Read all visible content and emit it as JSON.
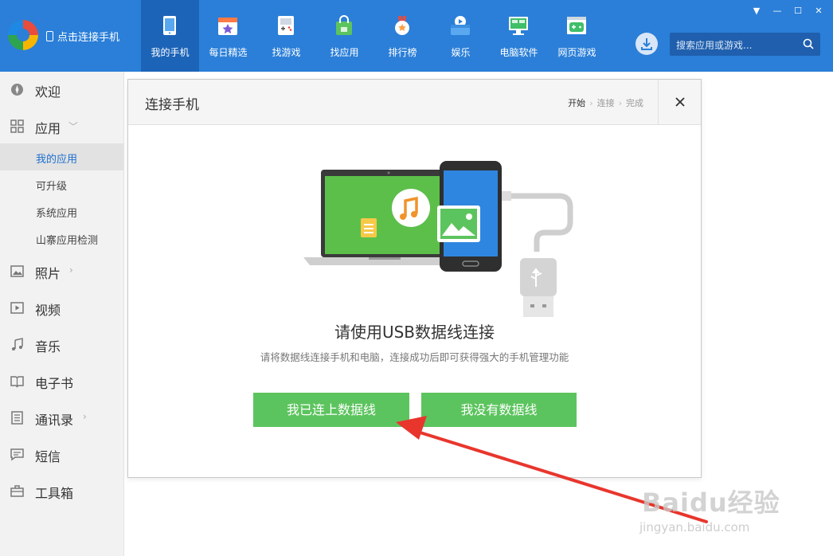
{
  "header": {
    "connect_label": "点击连接手机",
    "search_placeholder": "搜索应用或游戏...",
    "nav": [
      {
        "label": "我的手机",
        "icon": "phone-icon",
        "active": true
      },
      {
        "label": "每日精选",
        "icon": "calendar-star-icon"
      },
      {
        "label": "找游戏",
        "icon": "gamepad-icon"
      },
      {
        "label": "找应用",
        "icon": "shopping-bag-icon"
      },
      {
        "label": "排行榜",
        "icon": "medal-icon"
      },
      {
        "label": "娱乐",
        "icon": "play-box-icon"
      },
      {
        "label": "电脑软件",
        "icon": "monitor-icon"
      },
      {
        "label": "网页游戏",
        "icon": "web-game-icon"
      }
    ]
  },
  "sidebar": {
    "items": [
      {
        "label": "欢迎",
        "icon": "compass-icon"
      },
      {
        "label": "应用",
        "icon": "grid-icon"
      },
      {
        "label": "照片",
        "icon": "photo-icon"
      },
      {
        "label": "视频",
        "icon": "video-icon"
      },
      {
        "label": "音乐",
        "icon": "music-note-icon"
      },
      {
        "label": "电子书",
        "icon": "book-icon"
      },
      {
        "label": "通讯录",
        "icon": "contacts-icon"
      },
      {
        "label": "短信",
        "icon": "message-icon"
      },
      {
        "label": "工具箱",
        "icon": "toolbox-icon"
      }
    ],
    "app_sub": [
      {
        "label": "我的应用",
        "active": true
      },
      {
        "label": "可升级"
      },
      {
        "label": "系统应用"
      },
      {
        "label": "山寨应用检测"
      }
    ]
  },
  "dialog": {
    "title": "连接手机",
    "steps": [
      "开始",
      "连接",
      "完成"
    ],
    "heading": "请使用USB数据线连接",
    "subtext": "请将数据线连接手机和电脑，连接成功后即可获得强大的手机管理功能",
    "btn_connected": "我已连上数据线",
    "btn_no_cable": "我没有数据线"
  },
  "watermark": {
    "text": "Baidu经验",
    "url": "jingyan.baidu.com"
  },
  "colors": {
    "header_bg": "#2b7fd8",
    "nav_active": "#1c64b8",
    "button_green": "#5cc45e",
    "annotation_red": "#e8362d",
    "sidebar_active_text": "#1e6fcf"
  }
}
